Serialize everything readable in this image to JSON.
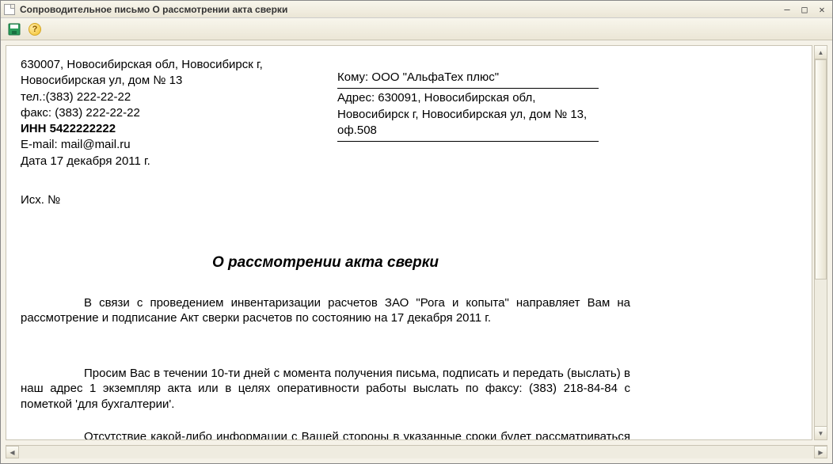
{
  "window": {
    "title": "Сопроводительное письмо О рассмотрении акта сверки"
  },
  "sender": {
    "address": "630007, Новосибирская обл, Новосибирск г, Новосибирская ул, дом № 13",
    "tel": "тел.:(383) 222-22-22",
    "fax": "факс: (383) 222-22-22",
    "inn": "ИНН 5422222222",
    "email": "E-mail: mail@mail.ru",
    "date": "Дата  17 декабря 2011 г."
  },
  "recipient": {
    "to": "Кому: ООО \"АльфаТех плюс\"",
    "address": "Адрес: 630091, Новосибирская обл, Новосибирск г, Новосибирская ул, дом № 13, оф.508"
  },
  "outNum": "Исх. №",
  "docTitle": "О рассмотрении акта сверки",
  "body": {
    "p1": "В связи с проведением инвентаризации расчетов ЗАО \"Рога и копыта\" направляет Вам на рассмотрение и подписание Акт сверки расчетов  по состоянию на 17 декабря 2011 г.",
    "p2": "Просим Вас в течении 10-ти дней с момента получения письма, подписать и передать (выслать) в наш адрес 1 экземпляр акта или в целях оперативности работы выслать по факсу: (383) 218-84-84 с пометкой 'для бухгалтерии'.",
    "p3": "Отсутствие какой-либо информации с Вашей стороны в указанные сроки будет рассматриваться нами как согласие с данными нашего учета."
  },
  "helpGlyph": "?"
}
